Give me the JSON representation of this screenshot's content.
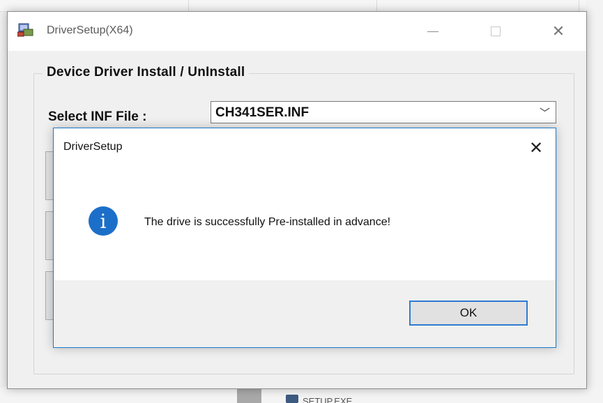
{
  "main_window": {
    "title": "DriverSetup(X64)",
    "app_icon": "driver-setup-icon",
    "group_title": "Device Driver Install / UnInstall",
    "inf_label": "Select INF File :",
    "inf_value": "CH341SER.INF"
  },
  "dialog": {
    "title": "DriverSetup",
    "icon": "info-icon",
    "message": "The drive is successfully Pre-installed in advance!",
    "ok_label": "OK"
  },
  "background": {
    "taskbar_item_text": "SETUP.EXE"
  },
  "colors": {
    "accent": "#1979ca",
    "info_icon": "#1c6fc8"
  }
}
